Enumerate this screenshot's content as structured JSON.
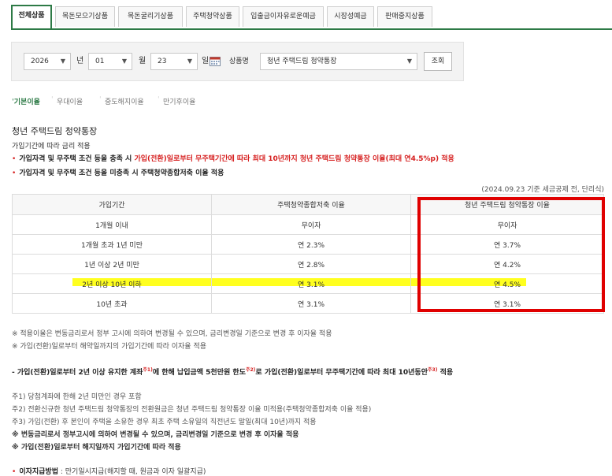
{
  "tabs": [
    {
      "label": "전체상품",
      "active": true
    },
    {
      "label": "목돈모으기상품",
      "active": false
    },
    {
      "label": "목돈굴리기상품",
      "active": false
    },
    {
      "label": "주택청약상품",
      "active": false
    },
    {
      "label": "입출금이자유로운예금",
      "active": false
    },
    {
      "label": "시장성예금",
      "active": false
    },
    {
      "label": "판매중지상품",
      "active": false
    }
  ],
  "search": {
    "year": "2026",
    "year_unit": "년",
    "month": "01",
    "month_unit": "월",
    "day": "23",
    "day_unit": "일",
    "product_label": "상품명",
    "product_value": "청년 주택드림 청약통장",
    "submit_label": "조회"
  },
  "subtabs": [
    "기본이율",
    "우대이율",
    "중도해지이율",
    "만기후이율"
  ],
  "product": {
    "title": "청년 주택드림 청약통장",
    "subtitle": "가입기간에 따라 금리 적용",
    "note1_prefix": "가입자격 및 무주택 조건 등을 충족 시 ",
    "note1_red": "가입(전환)일로부터 무주택기간에 따라 최대 10년까지 청년 주택드림 청약통장 이율(최대 연4.5%p) 적용",
    "note2": "가입자격 및 무주택 조건 등을 미충족 시 주택청약종합저축 이율 적용",
    "basis": "(2024.09.23 기준 세금공제 전, 단리식)"
  },
  "table": {
    "headers": [
      "가입기간",
      "주택청약종합저축 이율",
      "청년 주택드림 청약통장 이율"
    ],
    "rows": [
      [
        "1개월 이내",
        "무이자",
        "무이자"
      ],
      [
        "1개월 초과 1년 미만",
        "연 2.3%",
        "연 3.7%"
      ],
      [
        "1년 이상 2년 미만",
        "연 2.8%",
        "연 4.2%"
      ],
      [
        "2년 이상 10년 이하",
        "연 3.1%",
        "연 4.5%"
      ],
      [
        "10년 초과",
        "연 3.1%",
        "연 3.1%"
      ]
    ]
  },
  "notes": {
    "n1": "※ 적용이율은 변동금리로서 정부 고시에 의하여 변경될 수 있으며, 금리변경일 기준으로 변경 후 이자율 적용",
    "n2": "※ 가입(전환)일로부터 해약일까지의 가입기간에 따라 이자율 적용",
    "dash_a": "- 가입(전환)일로부터 2년 이상 유지한 계좌",
    "sup1": "주1)",
    "dash_b": "에 한해 납입금액 5천만원 한도",
    "sup2": "주2)",
    "dash_c": "로 가입(전환)일로부터 무주택기간에 따라 최대 10년동안",
    "sup3": "주3)",
    "dash_d": " 적용",
    "f1": "주1) 당첨계좌에 한해 2년 미만인 경우 포함",
    "f2": "주2) 전환신규한 청년 주택드림 청약통장의 전환원금은 청년 주택드림 청약통장 이율 미적용(주택청약종합저축 이율 적용)",
    "f3": "주3) 가입(전환) 후 본인이 주택을 소유한 경우 최초 주택 소유일의 직전년도 말일(최대 10년)까지 적용",
    "b1": "※ 변동금리로서 정부고시에 의하여 변경될 수 있으며, 금리변경일 기준으로 변경 후 이자율 적용",
    "b2": "※ 가입(전환)일로부터 해지일까지 가입기간에 따라 적용",
    "pay_label": "이자지급방법",
    "pay_value": " : 만기일시지급(해지할 때, 원금과 이자 일괄지급)"
  }
}
